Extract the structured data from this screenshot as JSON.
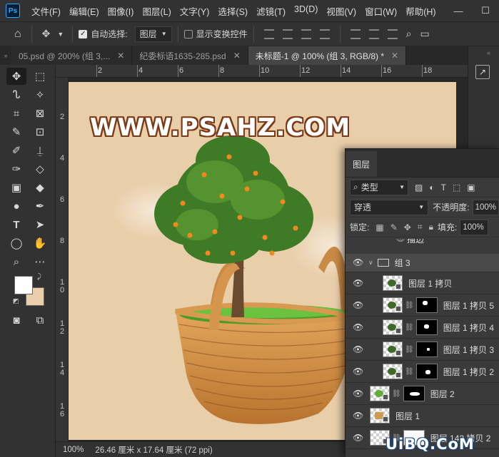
{
  "app": {
    "logo": "Ps"
  },
  "menu": [
    "文件(F)",
    "编辑(E)",
    "图像(I)",
    "图层(L)",
    "文字(Y)",
    "选择(S)",
    "滤镜(T)",
    "3D(D)",
    "视图(V)",
    "窗口(W)",
    "帮助(H)"
  ],
  "window": {
    "minimize": "—",
    "maximize": "☐",
    "close": "✕"
  },
  "options": {
    "auto_select_label": "自动选择:",
    "auto_select_checked": true,
    "auto_select_target": "图层",
    "transform_controls_label": "显示变换控件",
    "transform_controls_checked": false
  },
  "tabs": [
    {
      "label": "05.psd @ 200% (组 3,...",
      "active": false
    },
    {
      "label": "纪委标语1635-285.psd",
      "active": false
    },
    {
      "label": "未标题-1 @ 100% (组 3, RGB/8) *",
      "active": true
    }
  ],
  "rulers": {
    "h": [
      "2",
      "4",
      "6",
      "8",
      "10",
      "12",
      "14",
      "16",
      "18"
    ],
    "v": [
      "2",
      "4",
      "6",
      "8",
      "1 0",
      "1 2",
      "1 4",
      "1 6"
    ]
  },
  "canvas": {
    "watermark": "WWW.PSAHZ.COM",
    "background_color": "#e9ceaa"
  },
  "status": {
    "zoom": "100%",
    "doc_size": "26.46 厘米 x 17.64 厘米 (72 ppi)"
  },
  "layers_panel": {
    "tab": "图层",
    "filter_kind": "类型",
    "blend_mode": "穿透",
    "opacity_label": "不透明度:",
    "opacity": "100%",
    "lock_label": "锁定:",
    "fill_label": "填充:",
    "fill": "100%",
    "partial_row": "描边",
    "layers": [
      {
        "name": "组 3",
        "kind": "group"
      },
      {
        "name": "图层 1 拷贝",
        "mask": false,
        "indent": true
      },
      {
        "name": "图层 1 拷贝 5",
        "mask": true,
        "indent": true
      },
      {
        "name": "图层 1 拷贝 4",
        "mask": true,
        "indent": true
      },
      {
        "name": "图层 1 拷贝 3",
        "mask": true,
        "indent": true
      },
      {
        "name": "图层 1 拷贝 2",
        "mask": true,
        "indent": true
      },
      {
        "name": "图层 2",
        "mask": true,
        "indent": false
      },
      {
        "name": "图层 1",
        "mask": false,
        "indent": false
      },
      {
        "name": "图层 142 拷贝 2",
        "mask": true,
        "indent": false,
        "white_mask": true
      }
    ]
  },
  "corner_watermark": "UiBQ.CoM"
}
